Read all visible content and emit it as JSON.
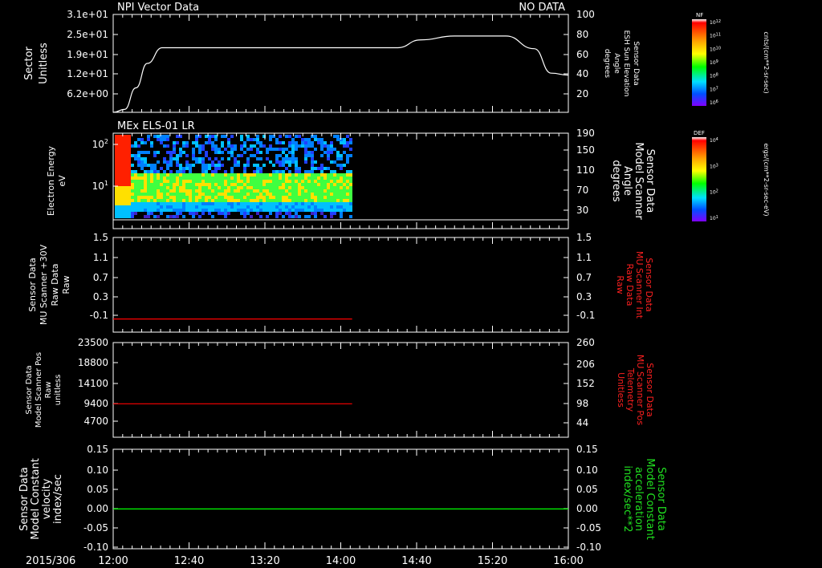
{
  "date_label": "2015/306",
  "time_ticks": [
    "12:00",
    "12:40",
    "13:20",
    "14:00",
    "14:40",
    "15:20",
    "16:00"
  ],
  "colors": {
    "axis": "#ffffff",
    "red": "#ff0000",
    "green": "#00ff00"
  },
  "chart_data": [
    {
      "type": "line",
      "title_left": "NPI Vector Data",
      "title_right": "NO DATA",
      "ylabel": [
        "Sector",
        "Unitless"
      ],
      "yticks": [
        "3.1e+01",
        "2.5e+01",
        "1.9e+01",
        "1.2e+01",
        "6.2e+00"
      ],
      "y2label": [
        "Sensor Data",
        "ESH Sun Elevation",
        "Angle",
        "degrees"
      ],
      "y2ticks": [
        "100",
        "80",
        "60",
        "40",
        "20"
      ],
      "y2lim": [
        0,
        100
      ],
      "xlim_hours": [
        12,
        16
      ],
      "series": [
        {
          "axis": "right",
          "x_hours": [
            12.0,
            12.1,
            12.2,
            12.3,
            12.43,
            13.0,
            13.5,
            14.5,
            14.7,
            15.0,
            15.3,
            15.45,
            15.7,
            15.85,
            16.0
          ],
          "values": [
            0,
            3,
            25,
            50,
            66,
            66,
            66,
            66,
            74,
            78,
            78,
            78,
            65,
            40,
            38
          ]
        }
      ],
      "colorbar": {
        "label": "NF",
        "units": "cnts/(cm**2-sr-sec)",
        "ticks": [
          "10^12",
          "10^11",
          "10^10",
          "10^9",
          "10^8",
          "10^7",
          "10^6"
        ]
      }
    },
    {
      "type": "heatmap",
      "title_left": "MEx ELS-01 LR",
      "ylabel": [
        "Electron Energy",
        "eV"
      ],
      "yticks": [
        "10^2",
        "10^1"
      ],
      "y2label": [
        "Sensor Data",
        "Model Scanner",
        "Angle",
        "degrees"
      ],
      "y2ticks": [
        "190",
        "150",
        "110",
        "70",
        "30"
      ],
      "data_end_time": "14:04",
      "colorbar": {
        "label": "DEF",
        "units": "ergs/(cm**2-sr-sec-eV)",
        "ticks": [
          "10^4",
          "10^3",
          "10^2",
          "10^1"
        ]
      }
    },
    {
      "type": "line",
      "ylabel": [
        "Sensor Data",
        "MU Scanner +30V",
        "Raw Data",
        "Raw"
      ],
      "yticks": [
        "1.5",
        "1.1",
        "0.7",
        "0.3",
        "-0.1"
      ],
      "y2label": [
        "Sensor Data",
        "MU Scanner Int",
        "Raw Data",
        "Raw"
      ],
      "y2ticks": [
        "1.5",
        "1.1",
        "0.7",
        "0.3",
        "-0.1"
      ],
      "ylim": [
        -0.3,
        1.5
      ],
      "series": [
        {
          "color": "red",
          "x_hours": [
            12.0,
            14.1
          ],
          "values": [
            -0.05,
            -0.05
          ]
        }
      ]
    },
    {
      "type": "line",
      "ylabel": [
        "Sensor Data",
        "Model Scanner Pos",
        "Raw",
        "unitless"
      ],
      "yticks": [
        "23500",
        "18800",
        "14100",
        "9400",
        "4700"
      ],
      "y2label": [
        "Sensor Data",
        "MU Scanner Pos",
        "Telemetry",
        "Unitless"
      ],
      "y2ticks": [
        "260",
        "206",
        "152",
        "98",
        "44"
      ],
      "ylim": [
        0,
        23500
      ],
      "series": [
        {
          "color": "red",
          "x_hours": [
            12.0,
            14.1
          ],
          "values": [
            8300,
            8300
          ]
        }
      ]
    },
    {
      "type": "line",
      "ylabel": [
        "Sensor Data",
        "Model Constant",
        "velocity",
        "index/sec"
      ],
      "yticks": [
        "0.15",
        "0.10",
        "0.05",
        "0.00",
        "-0.05",
        "-0.10"
      ],
      "y2label": [
        "Sensor Data",
        "Model Constant",
        "acceleration",
        "index/sec**2"
      ],
      "y2ticks": [
        "0.15",
        "0.10",
        "0.05",
        "0.00",
        "-0.05",
        "-0.10"
      ],
      "ylim": [
        -0.1,
        0.15
      ],
      "series": [
        {
          "color": "green",
          "x_hours": [
            12.0,
            16.0
          ],
          "values": [
            0,
            0
          ]
        }
      ]
    }
  ]
}
